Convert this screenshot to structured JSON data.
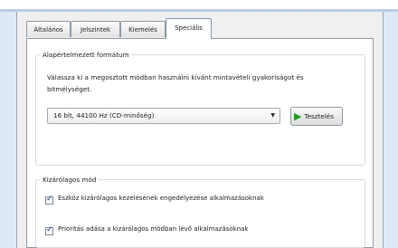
{
  "tabs": [
    "Általános",
    "Jelszintek",
    "Kiemelés",
    "Speciális"
  ],
  "active_tab": "Speciális",
  "default_format": {
    "legend": "Alapértelmezett formátum",
    "description": "Válassza ki a megosztott módban használni kívánt mintavételi gyakoriságot és bitmélységet.",
    "selected_format": "16 bit, 44100 Hz (CD-minőség)",
    "test_label": "Tesztelés"
  },
  "exclusive_mode": {
    "legend": "Kizárólagos mód",
    "checkbox1_label": "Eszköz kizárólagos kezelésének engedélyezése alkalmazásoknak",
    "checkbox1_checked": true,
    "checkbox2_label": "Prioritás adása a kizárólagos módban lévő alkalmazásoknak",
    "checkbox2_checked": true
  },
  "colors": {
    "window_bg": "#f0f0f0",
    "backdrop": "#dfe9f5",
    "play_icon": "#18a318"
  }
}
